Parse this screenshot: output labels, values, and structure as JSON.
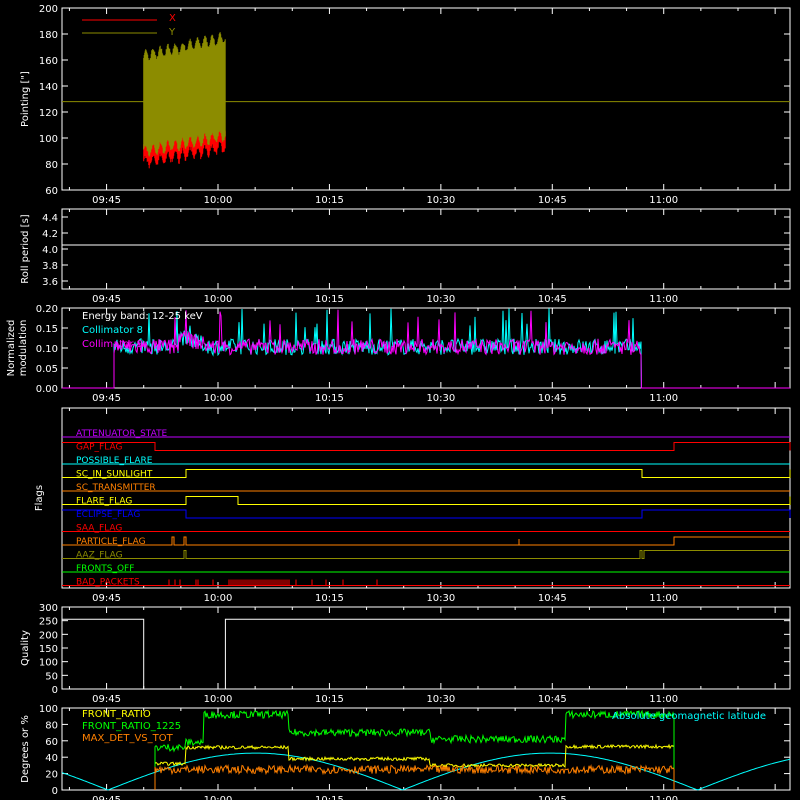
{
  "x_ticks": [
    "09:45",
    "10:00",
    "10:15",
    "10:30",
    "10:45",
    "11:00"
  ],
  "colors": {
    "background": "#000000",
    "axes": "#ffffff",
    "red": "#ff0000",
    "olive": "#8c8c00",
    "cyan": "#00ffff",
    "magenta": "#ff00ff",
    "yellow": "#ffff00",
    "blue": "#0000ff",
    "orange": "#ff8000",
    "green": "#00ff00",
    "violet": "#c000ff"
  },
  "chart_data": [
    {
      "type": "line",
      "ylabel": "Pointing [\"]",
      "ylim": [
        60,
        200
      ],
      "yticks": [
        "60",
        "80",
        "100",
        "120",
        "140",
        "160",
        "180",
        "200"
      ],
      "legend_position": "top-left",
      "series": [
        {
          "name": "X",
          "color": "#ff0000",
          "description_values": {
            "x_range": [
              "09:50",
              "10:01"
            ],
            "min": 77,
            "max": 170,
            "oscillating": true
          }
        },
        {
          "name": "Y",
          "color": "#8c8c00",
          "description_values": {
            "x_range": [
              "09:50",
              "10:01"
            ],
            "min": 85,
            "max": 182,
            "oscillating": true,
            "constant_line": 128
          }
        }
      ]
    },
    {
      "type": "line",
      "ylabel": "Roll period [s]",
      "ylim": [
        3.5,
        4.5
      ],
      "yticks": [
        "3.6",
        "3.8",
        "4.0",
        "4.2",
        "4.4"
      ],
      "series": [
        {
          "color": "#ffffff",
          "constant_value": 4.05
        }
      ]
    },
    {
      "type": "line",
      "ylabel_lines": [
        "Normalized",
        "modulation"
      ],
      "ylim": [
        0,
        0.2
      ],
      "yticks": [
        "0.00",
        "0.05",
        "0.10",
        "0.15",
        "0.20"
      ],
      "annotation": "Energy band: 12-25 keV",
      "series": [
        {
          "name": "Collimator 8",
          "color": "#00ffff",
          "x_range": [
            "09:46",
            "10:57"
          ],
          "mean": 0.105,
          "spread": 0.02
        },
        {
          "name": "Collimator 9",
          "color": "#ff00ff",
          "x_range": [
            "09:46",
            "10:57"
          ],
          "mean": 0.102,
          "spread": 0.02
        }
      ]
    },
    {
      "type": "line",
      "ylabel": "Flags",
      "flags": [
        {
          "name": "ATTENUATOR_STATE",
          "color": "#c000ff"
        },
        {
          "name": "GAP_FLAG",
          "color": "#ff0000"
        },
        {
          "name": "POSSIBLE_FLARE",
          "color": "#00ffff"
        },
        {
          "name": "SC_IN_SUNLIGHT",
          "color": "#ffff00"
        },
        {
          "name": "SC_TRANSMITTER",
          "color": "#ff8000"
        },
        {
          "name": "FLARE_FLAG",
          "color": "#ffff00"
        },
        {
          "name": "ECLIPSE_FLAG",
          "color": "#0000ff"
        },
        {
          "name": "SAA_FLAG",
          "color": "#ff0000"
        },
        {
          "name": "PARTICLE_FLAG",
          "color": "#ff8000"
        },
        {
          "name": "AAZ_FLAG",
          "color": "#8c8c00"
        },
        {
          "name": "FRONTS_OFF",
          "color": "#00ff00"
        },
        {
          "name": "BAD_PACKETS",
          "color": "#ff0000"
        }
      ]
    },
    {
      "type": "line",
      "ylabel": "Quality",
      "ylim": [
        0,
        300
      ],
      "yticks": [
        "0",
        "50",
        "100",
        "150",
        "200",
        "250",
        "300"
      ],
      "series": [
        {
          "color": "#ffffff",
          "segments": [
            {
              "x": [
                "09:39",
                "09:50"
              ],
              "y": 255
            },
            {
              "x": [
                "10:01",
                "11:15"
              ],
              "y": 255
            }
          ]
        }
      ]
    },
    {
      "type": "line",
      "ylabel": "Degrees or %",
      "ylim": [
        0,
        100
      ],
      "yticks": [
        "0",
        "20",
        "40",
        "60",
        "80",
        "100"
      ],
      "series": [
        {
          "name": "FRONT_RATIO",
          "color": "#ffff00"
        },
        {
          "name": "FRONT_RATIO_1225",
          "color": "#00ff00"
        },
        {
          "name": "MAX_DET_VS_TOT",
          "color": "#ff8000"
        },
        {
          "name": "Absolute geomagnetic latitude",
          "color": "#00ffff"
        }
      ]
    }
  ]
}
